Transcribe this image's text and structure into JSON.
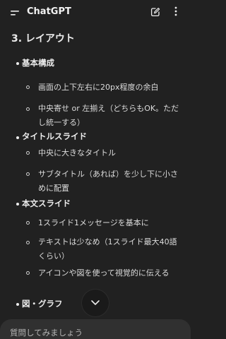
{
  "header": {
    "title": "ChatGPT",
    "icons": [
      "menu-icon",
      "edit-icon",
      "more-vertical-icon"
    ]
  },
  "message": {
    "section_title": "3. レイアウト",
    "groups": [
      {
        "title": "基本構成",
        "items": [
          "画面の上下左右に20px程度の余白",
          "中央寄せ or 左揃え（どちらもOK。ただし統一する）"
        ]
      },
      {
        "title": "タイトルスライド",
        "items": [
          "中央に大きなタイトル",
          "サブタイトル（あれば）を少し下に小さめに配置"
        ]
      },
      {
        "title": "本文スライド",
        "items": [
          "1スライド1メッセージを基本に",
          "テキストは少なめ（1スライド最大40語くらい）",
          "アイコンや図を使って視覚的に伝える"
        ]
      },
      {
        "title": "図・グラフ",
        "items": []
      }
    ]
  },
  "composer": {
    "placeholder": "質問してみましょう"
  }
}
